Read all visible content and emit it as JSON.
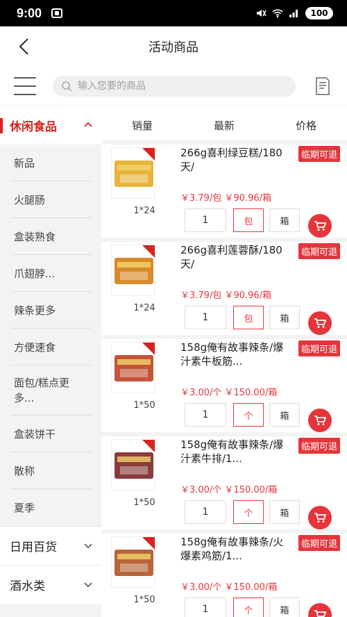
{
  "status_bar": {
    "time": "9:00",
    "battery": "100"
  },
  "header": {
    "title": "活动商品"
  },
  "search": {
    "placeholder": "输入您要的商品"
  },
  "sidebar": {
    "active_category": "休闲食品",
    "sub_items": [
      "新品",
      "火腿肠",
      "盒装熟食",
      "爪翅脖...",
      "辣条更多",
      "方便速食",
      "面包/糕点更多...",
      "盒装饼干",
      "散称",
      "夏季"
    ],
    "categories": [
      "日用百货",
      "酒水类"
    ]
  },
  "sort_tabs": [
    "销量",
    "最新",
    "价格"
  ],
  "products": [
    {
      "name": "266g喜利绿豆糕/180天/",
      "tag": "临期可退",
      "price": "￥3.79/包  ￥90.96/箱",
      "spec": "1*24",
      "qty": "1",
      "unit_a": "包",
      "unit_b": "箱",
      "pack_color": "#e9b43c"
    },
    {
      "name": "266g喜利莲蓉酥/180天/",
      "tag": "临期可退",
      "price": "￥3.79/包  ￥90.96/箱",
      "spec": "1*24",
      "qty": "1",
      "unit_a": "包",
      "unit_b": "箱",
      "pack_color": "#d98a2b"
    },
    {
      "name": "158g俺有故事辣条/爆汁素牛板筋...",
      "tag": "临期可退",
      "price": "￥3.00/个  ￥150.00/箱",
      "spec": "1*50",
      "qty": "1",
      "unit_a": "个",
      "unit_b": "箱",
      "pack_color": "#c5543a"
    },
    {
      "name": "158g俺有故事辣条/爆汁素牛排/1...",
      "tag": "临期可退",
      "price": "￥3.00/个  ￥150.00/箱",
      "spec": "1*50",
      "qty": "1",
      "unit_a": "个",
      "unit_b": "箱",
      "pack_color": "#8a3b3b"
    },
    {
      "name": "158g俺有故事辣条/火爆素鸡筋/1...",
      "tag": "临期可退",
      "price": "￥3.00/个  ￥150.00/箱",
      "spec": "1*50",
      "qty": "1",
      "unit_a": "个",
      "unit_b": "箱",
      "pack_color": "#b8643a"
    }
  ],
  "colors": {
    "accent": "#e5353b",
    "active": "#d9231f"
  }
}
